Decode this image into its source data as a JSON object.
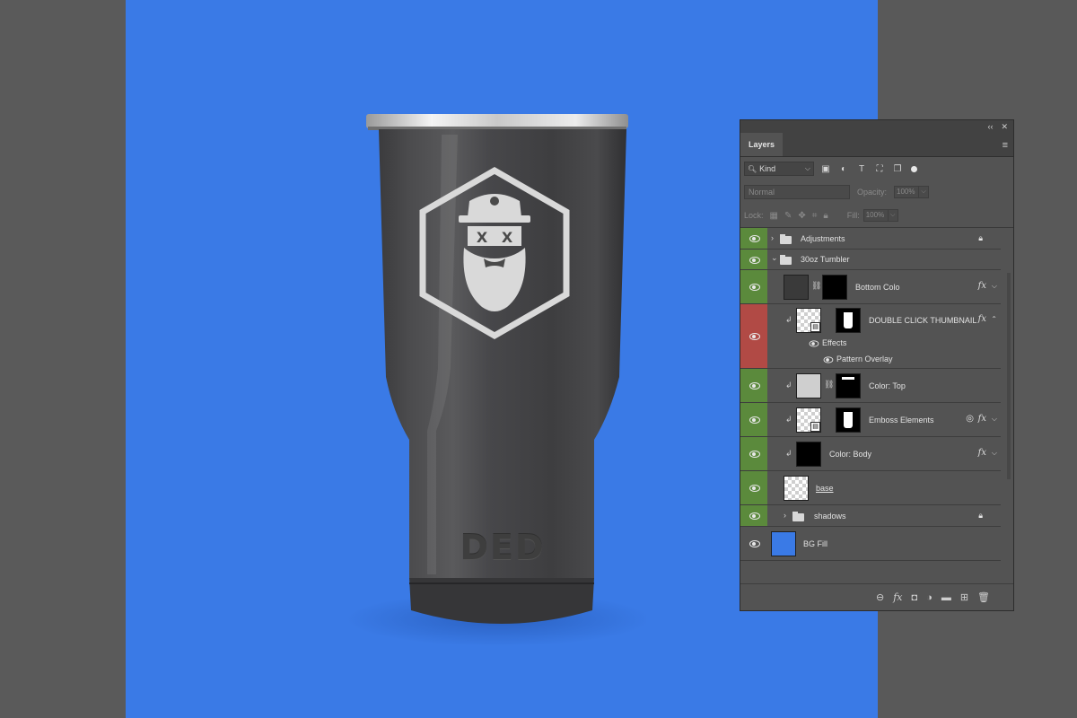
{
  "panel": {
    "title": "Layers",
    "collapse_glyph": "‹‹",
    "close_glyph": "✕",
    "menu_glyph": "≡",
    "filter": {
      "kind_label": "Kind",
      "kind_search_glyph": "🔍︎",
      "caret_glyph": "⌵",
      "icons": [
        "pixel-filter-icon",
        "adjustment-filter-icon",
        "type-filter-icon",
        "shape-filter-icon",
        "smart-object-filter-icon"
      ],
      "icon_glyphs": [
        "▣",
        "◐",
        "T",
        "⛶",
        "❐"
      ]
    },
    "blend_mode": "Normal",
    "opacity_label": "Opacity:",
    "opacity_value": "100%",
    "lock_label": "Lock:",
    "lock_icons": [
      "lock-transparent-icon",
      "lock-image-icon",
      "lock-position-icon",
      "lock-artboard-icon",
      "lock-all-icon"
    ],
    "lock_glyphs": [
      "▦",
      "✎",
      "✥",
      "⌗",
      "🔒︎"
    ],
    "fill_label": "Fill:",
    "fill_value": "100%"
  },
  "layers": [
    {
      "name": "Adjustments",
      "kind": "group",
      "visible": true,
      "locked": true,
      "expanded": false
    },
    {
      "name": "30oz Tumbler",
      "kind": "group",
      "visible": true,
      "expanded": true
    },
    {
      "name": "Bottom Colo",
      "kind": "layer",
      "visible": true,
      "fx": true
    },
    {
      "name": "DOUBLE CLICK THUMBNAIL",
      "kind": "smart-object",
      "visible": true,
      "fx": true,
      "highlight": "red",
      "effects_label": "Effects",
      "effect": "Pattern Overlay"
    },
    {
      "name": "Color: Top",
      "kind": "layer",
      "visible": true
    },
    {
      "name": "Emboss Elements",
      "kind": "smart-object",
      "visible": true,
      "fx": true
    },
    {
      "name": "Color: Body",
      "kind": "layer",
      "visible": true,
      "fx": true
    },
    {
      "name": "base",
      "kind": "layer",
      "visible": true
    },
    {
      "name": "shadows",
      "kind": "group",
      "visible": true,
      "locked": true,
      "expanded": false
    },
    {
      "name": "BG Fill",
      "kind": "layer",
      "visible": true
    }
  ],
  "glyphs": {
    "fx": "fx",
    "chevron_right": "›",
    "chevron_down": "⌄",
    "caret_down": "⌵",
    "caret_up": "⌃",
    "chain": "⛓",
    "clip": "↲",
    "lock": "🔒︎",
    "smart_badge": "▤",
    "half_circle": "◎"
  },
  "footer": {
    "icons": [
      "link-layers-icon",
      "add-style-icon",
      "add-mask-icon",
      "new-adjustment-icon",
      "new-group-icon",
      "new-layer-icon",
      "delete-layer-icon"
    ],
    "glyphs": [
      "⊖",
      "fx",
      "◘",
      "◑",
      "▬",
      "⊞",
      "🗑︎"
    ]
  },
  "canvas": {
    "background_color": "#3a7ae6",
    "product": "tumbler",
    "emboss_text": "DED"
  },
  "colors": {
    "eye_green": "#5b8a3c",
    "eye_red": "#b14a45",
    "panel_bg": "#535353"
  }
}
